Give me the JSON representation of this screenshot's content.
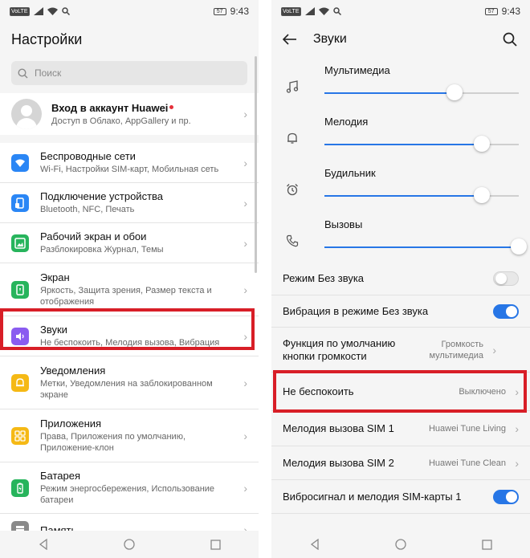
{
  "status": {
    "time": "9:43",
    "battery": "57",
    "chip": "VoLTE"
  },
  "left": {
    "title": "Настройки",
    "search": {
      "placeholder": "Поиск"
    },
    "account": {
      "title": "Вход в аккаунт Huawei",
      "subtitle": "Доступ в Облако, AppGallery и пр."
    },
    "items": [
      {
        "title": "Беспроводные сети",
        "subtitle": "Wi-Fi, Настройки SIM-карт, Мобильная сеть",
        "icon": "wifi-icon",
        "color": "#2a86f5"
      },
      {
        "title": "Подключение устройства",
        "subtitle": "Bluetooth, NFC, Печать",
        "icon": "device-connection-icon",
        "color": "#2a86f5"
      },
      {
        "title": "Рабочий экран и обои",
        "subtitle": "Разблокировка Журнал, Темы",
        "icon": "wallpaper-icon",
        "color": "#27b45c"
      },
      {
        "title": "Экран",
        "subtitle": "Яркость, Защита зрения, Размер текста и отображения",
        "icon": "display-icon",
        "color": "#27b45c"
      },
      {
        "title": "Звуки",
        "subtitle": "Не беспокоить, Мелодия вызова, Вибрация",
        "icon": "sound-icon",
        "color": "#8a5cf0"
      },
      {
        "title": "Уведомления",
        "subtitle": "Метки, Уведомления на заблокированном экране",
        "icon": "notification-bell-icon",
        "color": "#f5b915"
      },
      {
        "title": "Приложения",
        "subtitle": "Права, Приложения по умолчанию, Приложение-клон",
        "icon": "apps-grid-icon",
        "color": "#f5b915"
      },
      {
        "title": "Батарея",
        "subtitle": "Режим энергосбережения, Использование батареи",
        "icon": "battery-icon",
        "color": "#27b45c"
      },
      {
        "title": "Память",
        "subtitle": "",
        "icon": "storage-icon",
        "color": "#8a8a8a"
      }
    ]
  },
  "right": {
    "title": "Звуки",
    "volumes": [
      {
        "label": "Мультимедиа",
        "level": 0.67,
        "icon": "music-note-icon"
      },
      {
        "label": "Мелодия",
        "level": 0.81,
        "icon": "bell-icon"
      },
      {
        "label": "Будильник",
        "level": 0.81,
        "icon": "alarm-clock-icon"
      },
      {
        "label": "Вызовы",
        "level": 1.0,
        "icon": "phone-icon"
      }
    ],
    "rows": {
      "silent": {
        "label": "Режим Без звука",
        "on": false
      },
      "vibrate_silent": {
        "label": "Вибрация в режиме Без звука",
        "on": true
      },
      "volume_key": {
        "label": "Функция по умолчанию кнопки громкости",
        "value": "Громкость мультимедиа"
      },
      "dnd": {
        "label": "Не беспокоить",
        "value": "Выключено"
      },
      "sim1": {
        "label": "Мелодия вызова SIM 1",
        "value": "Huawei Tune Living"
      },
      "sim2": {
        "label": "Мелодия вызова SIM 2",
        "value": "Huawei Tune Clean"
      },
      "vibro_sim1": {
        "label": "Вибросигнал и мелодия SIM-карты 1",
        "on": true
      }
    }
  },
  "highlight_color": "#d81e27",
  "accent_color": "#2776e6"
}
